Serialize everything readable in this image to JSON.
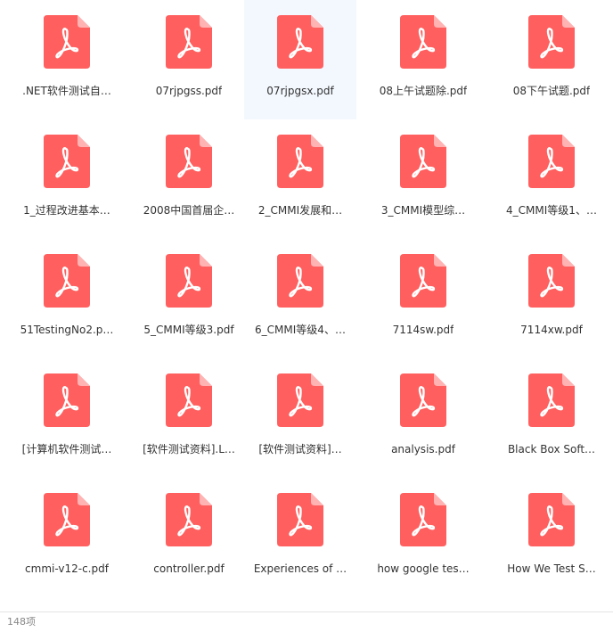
{
  "files": [
    {
      "name": ".NET软件测试自…",
      "icon": "pdf-file-icon"
    },
    {
      "name": "07rjpgss.pdf",
      "icon": "pdf-file-icon"
    },
    {
      "name": "07rjpgsx.pdf",
      "icon": "pdf-file-icon",
      "selected": true
    },
    {
      "name": "08上午试题除.pdf",
      "icon": "pdf-file-icon"
    },
    {
      "name": "08下午试题.pdf",
      "icon": "pdf-file-icon"
    },
    {
      "name": "1_过程改进基本…",
      "icon": "pdf-file-icon"
    },
    {
      "name": "2008中国首届企…",
      "icon": "pdf-file-icon"
    },
    {
      "name": "2_CMMI发展和…",
      "icon": "pdf-file-icon"
    },
    {
      "name": "3_CMMI模型综…",
      "icon": "pdf-file-icon"
    },
    {
      "name": "4_CMMI等级1、…",
      "icon": "pdf-file-icon"
    },
    {
      "name": "51TestingNo2.p…",
      "icon": "pdf-file-icon"
    },
    {
      "name": "5_CMMI等级3.pdf",
      "icon": "pdf-file-icon"
    },
    {
      "name": "6_CMMI等级4、…",
      "icon": "pdf-file-icon"
    },
    {
      "name": "7114sw.pdf",
      "icon": "pdf-file-icon"
    },
    {
      "name": "7114xw.pdf",
      "icon": "pdf-file-icon"
    },
    {
      "name": "[计算机软件测试…",
      "icon": "pdf-file-icon"
    },
    {
      "name": "[软件测试资料].L…",
      "icon": "pdf-file-icon"
    },
    {
      "name": "[软件测试资料]…",
      "icon": "pdf-file-icon"
    },
    {
      "name": "analysis.pdf",
      "icon": "pdf-file-icon"
    },
    {
      "name": "Black Box Soft…",
      "icon": "pdf-file-icon"
    },
    {
      "name": "cmmi-v12-c.pdf",
      "icon": "pdf-file-icon"
    },
    {
      "name": "controller.pdf",
      "icon": "pdf-file-icon"
    },
    {
      "name": "Experiences of …",
      "icon": "pdf-file-icon"
    },
    {
      "name": "how google tes…",
      "icon": "pdf-file-icon"
    },
    {
      "name": "How We Test S…",
      "icon": "pdf-file-icon"
    }
  ],
  "footer": {
    "item_count": "148项"
  },
  "colors": {
    "pdf_icon": "#ff5f5f",
    "pdf_icon_fold": "#ffb3b3",
    "selected_bg": "#f3f8fe"
  }
}
